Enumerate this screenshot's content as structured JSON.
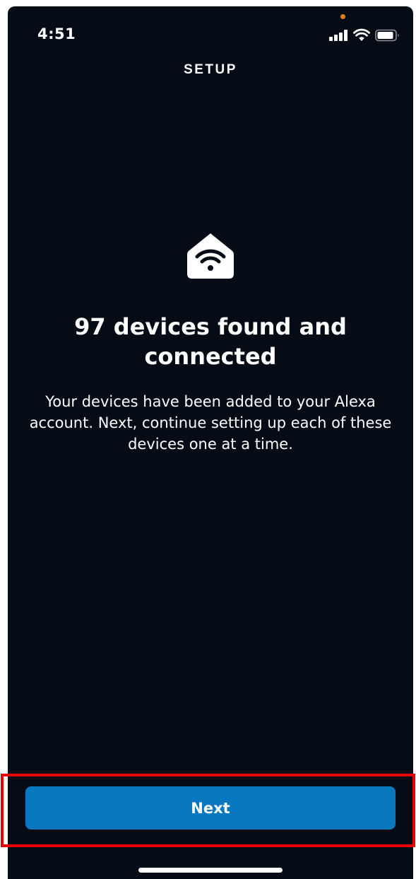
{
  "status_bar": {
    "time": "4:51",
    "signal_icon": "cellular-signal-icon",
    "wifi_icon": "wifi-icon",
    "battery_icon": "battery-icon",
    "privacy_dot_color": "#e07f19"
  },
  "header": {
    "title": "SETUP"
  },
  "main": {
    "icon": "home-wifi-icon",
    "headline": "97 devices found and connected",
    "description": "Your devices have been added to your Alexa account. Next, continue setting up each of these devices one at a time."
  },
  "footer": {
    "next_label": "Next"
  },
  "colors": {
    "background": "#050c15",
    "accent": "#0a78c0",
    "highlight": "#e60000"
  }
}
